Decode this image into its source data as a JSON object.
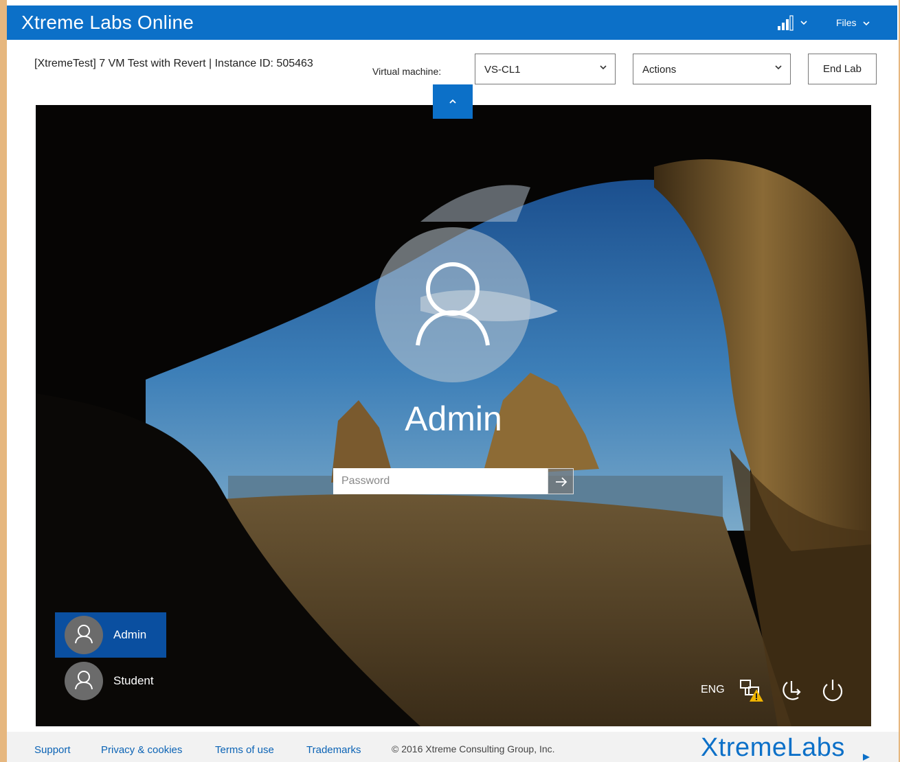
{
  "header": {
    "title": "Xtreme Labs Online",
    "files_label": "Files",
    "signal_icon": "signal-strength-icon"
  },
  "toolbar": {
    "lab_title": "[XtremeTest] 7 VM Test with Revert | Instance ID: 505463",
    "vm_label": "Virtual machine:",
    "vm_selected": "VS-CL1",
    "actions_label": "Actions",
    "end_lab_label": "End Lab"
  },
  "vm": {
    "user_name": "Admin",
    "password_placeholder": "Password",
    "users": [
      {
        "label": "Admin",
        "selected": true
      },
      {
        "label": "Student",
        "selected": false
      }
    ],
    "tray": {
      "language": "ENG",
      "icons": [
        "network-warning-icon",
        "ease-of-access-icon",
        "power-icon"
      ]
    }
  },
  "footer": {
    "links": [
      "Support",
      "Privacy & cookies",
      "Terms of use",
      "Trademarks"
    ],
    "copyright": "© 2016 Xtreme Consulting Group, Inc.",
    "brand": "XtremeLabs"
  },
  "colors": {
    "accent": "#0c70c8",
    "selected_tile": "#0a4fa0",
    "frame_border": "#e6b77f"
  }
}
